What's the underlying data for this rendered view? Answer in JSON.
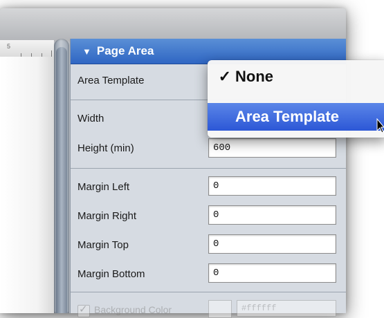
{
  "ruler": {
    "number": "5"
  },
  "panel": {
    "title": "Page Area",
    "fields": [
      {
        "label": "Area Template",
        "value": ""
      },
      {
        "label": "Width",
        "value": ""
      },
      {
        "label": "Height (min)",
        "value": "600"
      },
      {
        "label": "Margin Left",
        "value": "0"
      },
      {
        "label": "Margin Right",
        "value": "0"
      },
      {
        "label": "Margin Top",
        "value": "0"
      },
      {
        "label": "Margin Bottom",
        "value": "0"
      }
    ],
    "background_color": {
      "label": "Background Color",
      "checked": true,
      "hex": "#ffffff"
    }
  },
  "menu": {
    "items": [
      {
        "label": "None",
        "checked": true,
        "highlighted": false
      },
      {
        "label": "Area Template",
        "checked": false,
        "highlighted": true
      }
    ]
  },
  "colors": {
    "header_blue": "#3a72cc",
    "menu_highlight": "#3b66dc"
  },
  "icons": {
    "disclosure": "triangle-down-icon",
    "check": "checkmark-icon",
    "cursor": "arrow-cursor-icon"
  }
}
